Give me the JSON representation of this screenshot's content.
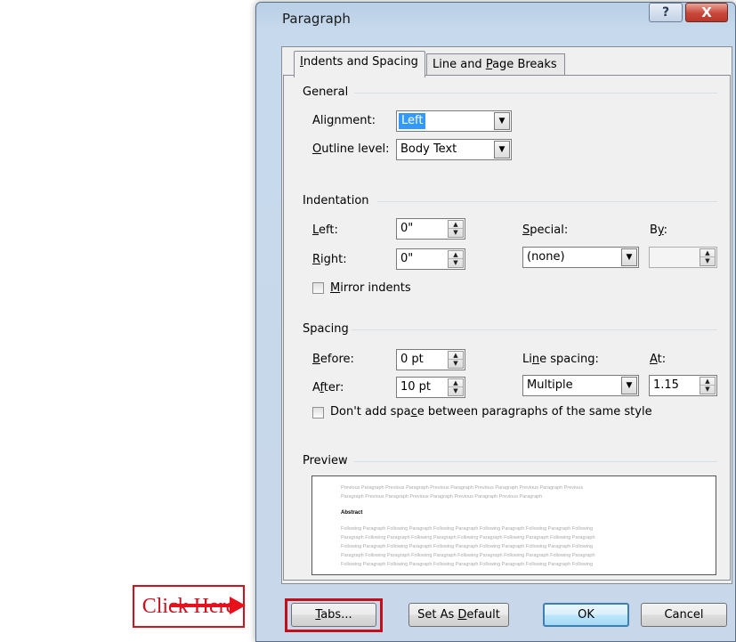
{
  "dialog": {
    "title": "Paragraph",
    "help_glyph": "?",
    "close_glyph": "X",
    "tabs": [
      {
        "pre": "",
        "u": "I",
        "post": "ndents and Spacing"
      },
      {
        "pre": "Line and ",
        "u": "P",
        "post": "age Breaks"
      }
    ]
  },
  "general": {
    "heading": "General",
    "alignment": {
      "pre": "Ali",
      "u": "g",
      "post": "nment:",
      "value": "Left"
    },
    "outline": {
      "pre": "",
      "u": "O",
      "post": "utline level:",
      "value": "Body Text"
    }
  },
  "indentation": {
    "heading": "Indentation",
    "left": {
      "pre": "",
      "u": "L",
      "post": "eft:",
      "value": "0\""
    },
    "right": {
      "pre": "",
      "u": "R",
      "post": "ight:",
      "value": "0\""
    },
    "special": {
      "pre": "",
      "u": "S",
      "post": "pecial:",
      "value": "(none)"
    },
    "by": {
      "pre": "B",
      "u": "y",
      "post": ":",
      "value": ""
    },
    "mirror": {
      "pre": "",
      "u": "M",
      "post": "irror indents",
      "checked": false
    }
  },
  "spacing": {
    "heading": "Spacing",
    "before": {
      "pre": "",
      "u": "B",
      "post": "efore:",
      "value": "0 pt"
    },
    "after": {
      "pre": "A",
      "u": "f",
      "post": "ter:",
      "value": "10 pt"
    },
    "line_spacing": {
      "pre": "Li",
      "u": "n",
      "post": "e spacing:",
      "value": "Multiple"
    },
    "at": {
      "pre": "",
      "u": "A",
      "post": "t:",
      "value": "1.15"
    },
    "dont_add": {
      "pre": "Don't add spa",
      "u": "c",
      "post": "e between paragraphs of the same style",
      "checked": false
    }
  },
  "preview": {
    "heading": "Preview",
    "previous_lines": [
      "Previous Paragraph Previous Paragraph Previous Paragraph Previous Paragraph Previous Paragraph Previous",
      "Paragraph Previous Paragraph Previous Paragraph Previous Paragraph Previous Paragraph"
    ],
    "sample": "Abstract",
    "following_lines": [
      "Following Paragraph Following Paragraph Following Paragraph Following Paragraph Following Paragraph Following",
      "Paragraph Following Paragraph Following Paragraph Following Paragraph Following Paragraph Following Paragraph",
      "Following Paragraph Following Paragraph Following Paragraph Following Paragraph Following Paragraph Following",
      "Paragraph Following Paragraph Following Paragraph Following Paragraph Following Paragraph Following Paragraph",
      "Following Paragraph Following Paragraph Following Paragraph Following Paragraph Following Paragraph Following"
    ]
  },
  "buttons": {
    "tabs": {
      "pre": "",
      "u": "T",
      "post": "abs..."
    },
    "set_default": {
      "pre": "Set As ",
      "u": "D",
      "post": "efault"
    },
    "ok": "OK",
    "cancel": "Cancel"
  },
  "annotation": {
    "callout": "Click Here",
    "color": "#e8101b"
  }
}
